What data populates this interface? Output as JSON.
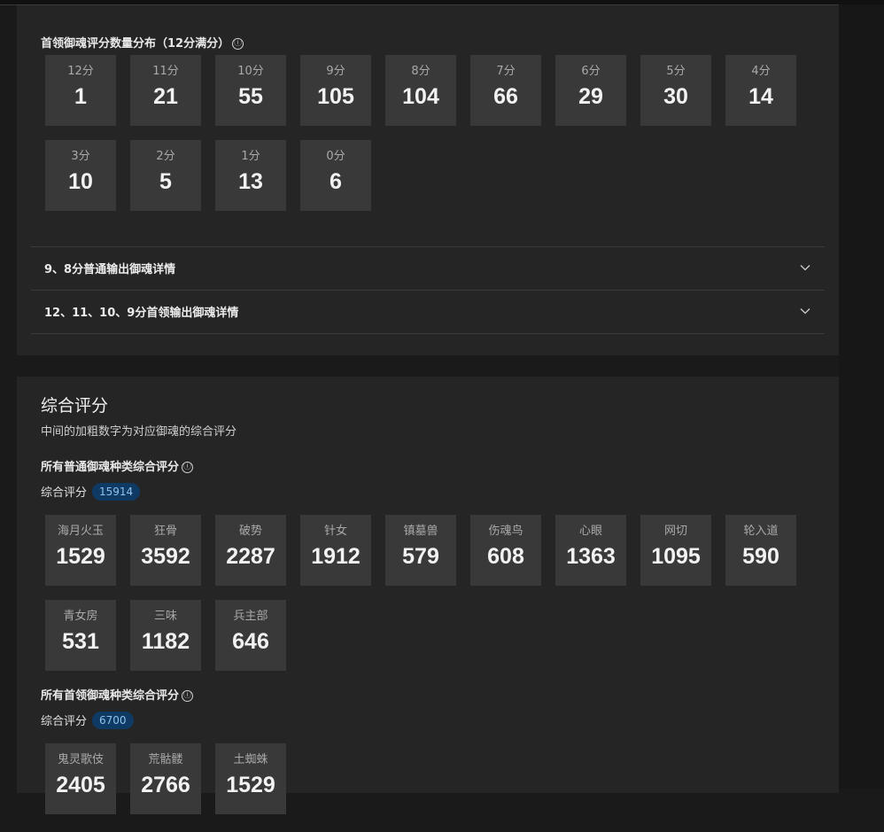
{
  "boss_distribution": {
    "title": "首领御魂评分数量分布（12分满分）",
    "info_icon": "ⓘ",
    "items": [
      {
        "label": "12分",
        "value": "1"
      },
      {
        "label": "11分",
        "value": "21"
      },
      {
        "label": "10分",
        "value": "55"
      },
      {
        "label": "9分",
        "value": "105"
      },
      {
        "label": "8分",
        "value": "104"
      },
      {
        "label": "7分",
        "value": "66"
      },
      {
        "label": "6分",
        "value": "29"
      },
      {
        "label": "5分",
        "value": "30"
      },
      {
        "label": "4分",
        "value": "14"
      },
      {
        "label": "3分",
        "value": "10"
      },
      {
        "label": "2分",
        "value": "5"
      },
      {
        "label": "1分",
        "value": "13"
      },
      {
        "label": "0分",
        "value": "6"
      }
    ]
  },
  "accordions": [
    {
      "title": "9、8分普通输出御魂详情",
      "icon": "chevron-down-icon"
    },
    {
      "title": "12、11、10、9分首领输出御魂详情",
      "icon": "chevron-down-icon"
    }
  ],
  "composite": {
    "title": "综合评分",
    "description": "中间的加粗数字为对应御魂的综合评分",
    "normal": {
      "title": "所有普通御魂种类综合评分",
      "info_icon": "ⓘ",
      "score_label": "综合评分",
      "score_value": "15914",
      "items": [
        {
          "label": "海月火玉",
          "value": "1529"
        },
        {
          "label": "狂骨",
          "value": "3592"
        },
        {
          "label": "破势",
          "value": "2287"
        },
        {
          "label": "针女",
          "value": "1912"
        },
        {
          "label": "镇墓兽",
          "value": "579"
        },
        {
          "label": "伤魂鸟",
          "value": "608"
        },
        {
          "label": "心眼",
          "value": "1363"
        },
        {
          "label": "网切",
          "value": "1095"
        },
        {
          "label": "轮入道",
          "value": "590"
        },
        {
          "label": "青女房",
          "value": "531"
        },
        {
          "label": "三味",
          "value": "1182"
        },
        {
          "label": "兵主部",
          "value": "646"
        }
      ]
    },
    "boss": {
      "title": "所有首领御魂种类综合评分",
      "info_icon": "ⓘ",
      "score_label": "综合评分",
      "score_value": "6700",
      "items": [
        {
          "label": "鬼灵歌伎",
          "value": "2405"
        },
        {
          "label": "荒骷髅",
          "value": "2766"
        },
        {
          "label": "土蜘蛛",
          "value": "1529"
        }
      ]
    }
  },
  "colors": {
    "page_bg": "#1a1a1a",
    "panel_bg": "#252525",
    "card_bg": "#393939",
    "badge_bg": "#0e3a64",
    "badge_text": "#8fc3f0"
  }
}
